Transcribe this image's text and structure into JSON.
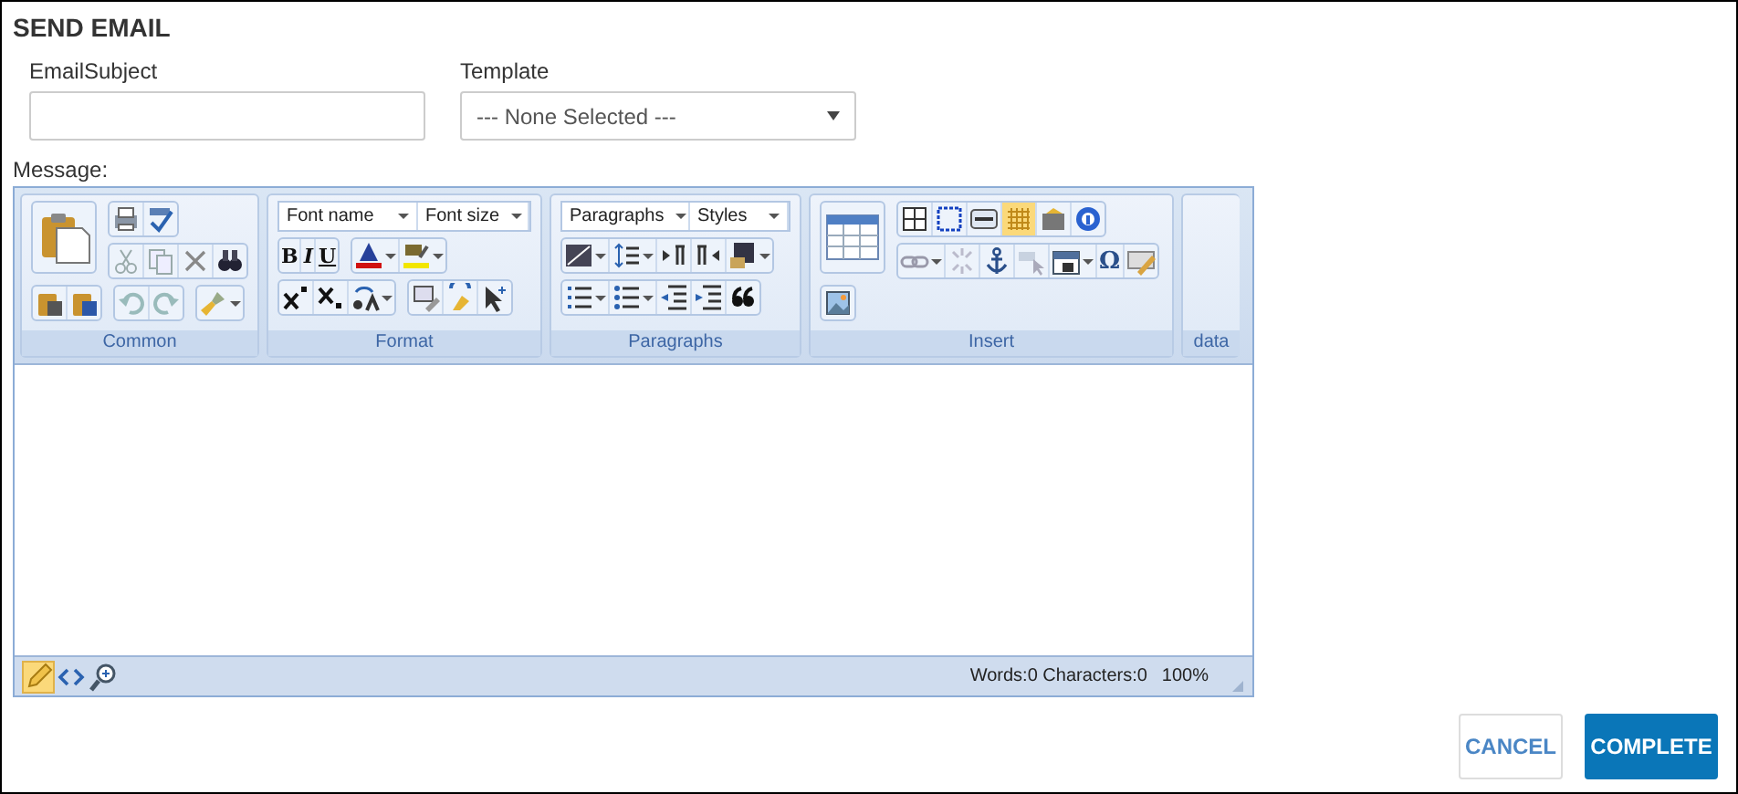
{
  "title": "SEND EMAIL",
  "subject": {
    "label": "EmailSubject"
  },
  "template": {
    "label": "Template",
    "value": "--- None Selected ---"
  },
  "message_label": "Message:",
  "toolbar": {
    "groups": [
      "Common",
      "Format",
      "Paragraphs",
      "Insert",
      "data"
    ],
    "dropdowns": [
      "Font name",
      "Font size",
      "Paragraphs",
      "Styles"
    ],
    "glyphs": {
      "bold": "B",
      "italic": "I",
      "underline": "U",
      "symbol": "Ω"
    },
    "grid_toggle": {
      "on": true
    }
  },
  "modes": [
    {
      "selected": true
    },
    {
      "selected": false
    },
    {
      "selected": false
    }
  ],
  "status": {
    "counts": "Words:0 Characters:0",
    "zoom": "100%"
  },
  "buttons": [
    {
      "label": "CANCEL",
      "kind": "secondary"
    },
    {
      "label": "COMPLETE",
      "kind": "primary"
    }
  ]
}
